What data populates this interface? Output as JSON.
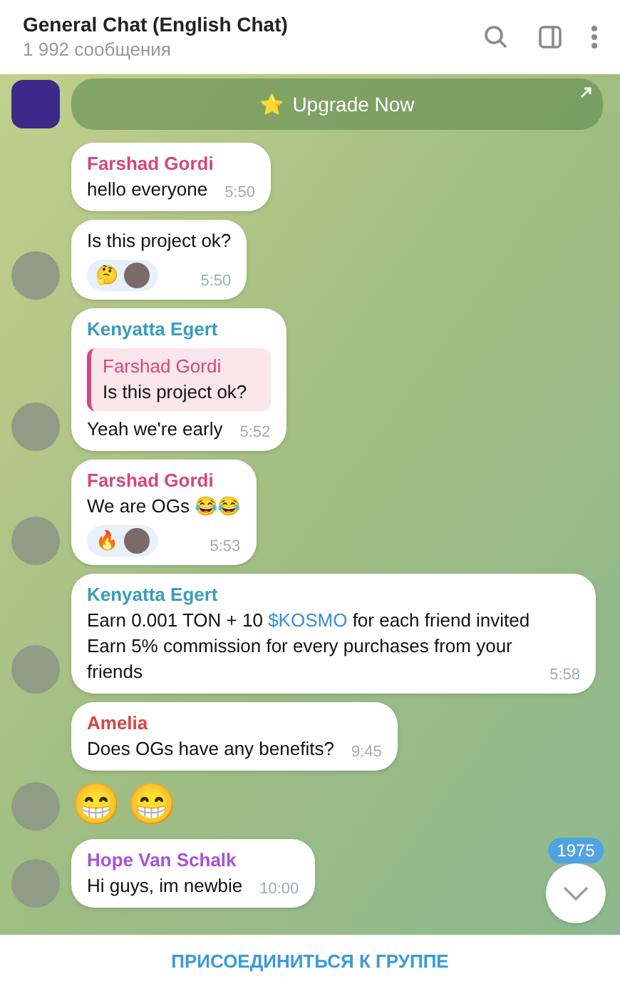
{
  "header": {
    "title": "General Chat (English Chat)",
    "subtitle": "1 992 сообщения"
  },
  "pinned_button": {
    "label": "Upgrade Now",
    "icon": "⭐"
  },
  "messages": [
    {
      "kind": "text",
      "sender": "Farshad Gordi",
      "color": "#d4477a",
      "avatar": false,
      "body": [
        {
          "kind": "plain",
          "text": "hello everyone"
        }
      ],
      "time": "5:50"
    },
    {
      "kind": "text",
      "avatar": true,
      "body": [
        {
          "kind": "plain",
          "text": "Is this project ok?"
        }
      ],
      "reactions": [
        {
          "emoji": "🤔"
        }
      ],
      "time": "5:50"
    },
    {
      "kind": "reply",
      "sender": "Kenyatta Egert",
      "color": "#3a9dbf",
      "avatar": true,
      "quote": {
        "sender": "Farshad Gordi",
        "text": "Is this project ok?"
      },
      "body": [
        {
          "kind": "plain",
          "text": "Yeah we're early"
        }
      ],
      "time": "5:52"
    },
    {
      "kind": "text",
      "sender": "Farshad Gordi",
      "color": "#d4477a",
      "avatar": true,
      "body": [
        {
          "kind": "plain",
          "text": "We are OGs 😂😂"
        }
      ],
      "reactions": [
        {
          "emoji": "🔥"
        }
      ],
      "time": "5:53"
    },
    {
      "kind": "text",
      "sender": "Kenyatta Egert",
      "color": "#3a9dbf",
      "avatar": true,
      "body": [
        {
          "kind": "plain",
          "text": "Earn 0.001 TON + 10 "
        },
        {
          "kind": "link",
          "text": "$KOSMO"
        },
        {
          "kind": "plain",
          "text": " for each friend invited Earn 5% commission for every purchases from your friends"
        }
      ],
      "time": "5:58"
    },
    {
      "kind": "text",
      "sender": "Amelia",
      "color": "#d24545",
      "avatar": false,
      "body": [
        {
          "kind": "plain",
          "text": "Does OGs have any benefits?"
        }
      ],
      "time": "9:45"
    },
    {
      "kind": "emoji",
      "avatar": true,
      "emojis": [
        "😁",
        "😁"
      ]
    },
    {
      "kind": "text",
      "sender": "Hope Van Schalk",
      "color": "#a653d9",
      "avatar": true,
      "body": [
        {
          "kind": "plain",
          "text": "Hi guys, im newbie"
        }
      ],
      "time": "10:00"
    }
  ],
  "scroll_button": {
    "badge": "1975"
  },
  "join_button": {
    "label": "ПРИСОЕДИНИТЬСЯ К ГРУППЕ"
  }
}
